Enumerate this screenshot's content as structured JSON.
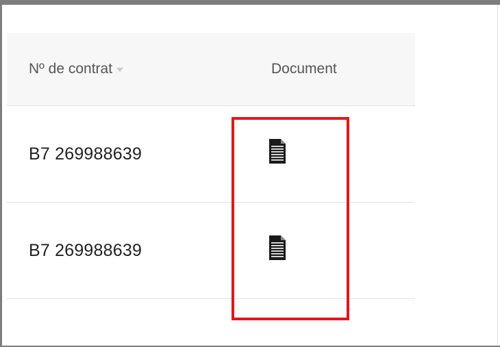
{
  "table": {
    "columns": {
      "contract_number": "Nº de contrat",
      "document": "Document"
    },
    "rows": [
      {
        "contract_number": "B7 269988639",
        "document_icon": "document-icon"
      },
      {
        "contract_number": "B7 269988639",
        "document_icon": "document-icon"
      }
    ]
  },
  "colors": {
    "highlight": "#e3161c",
    "header_background": "#f7f7f7",
    "icon": "#1a1a1a"
  }
}
